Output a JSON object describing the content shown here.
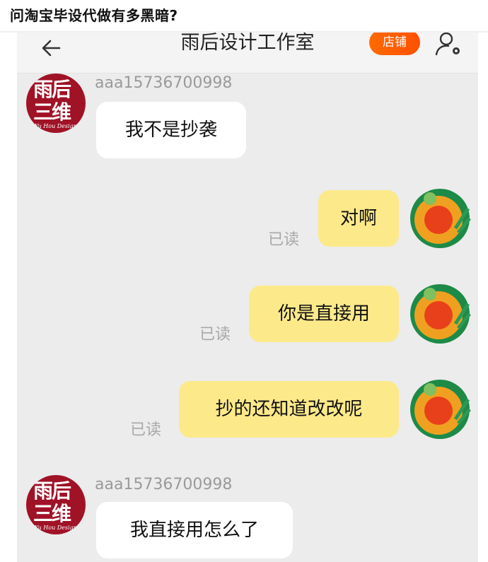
{
  "question": "问淘宝毕设代做有多黑暗?",
  "header": {
    "title": "雨后设计工作室",
    "shop_label": "店铺"
  },
  "shop_avatar": {
    "line1": "雨后",
    "line2": "三维",
    "sub": "Yu Hou Design"
  },
  "messages": [
    {
      "side": "left",
      "sender": "aaa15736700998",
      "text": "我不是抄袭"
    },
    {
      "side": "right",
      "text": "对啊",
      "status": "已读"
    },
    {
      "side": "right",
      "text": "你是直接用",
      "status": "已读"
    },
    {
      "side": "right",
      "text": "抄的还知道改改呢",
      "status": "已读"
    },
    {
      "side": "left",
      "sender": "aaa15736700998",
      "text": "我直接用怎么了"
    }
  ],
  "colors": {
    "accent": "#ff5000",
    "bubble_self": "#fce98a",
    "bubble_other": "#ffffff",
    "avatar_brand": "#a01226"
  }
}
